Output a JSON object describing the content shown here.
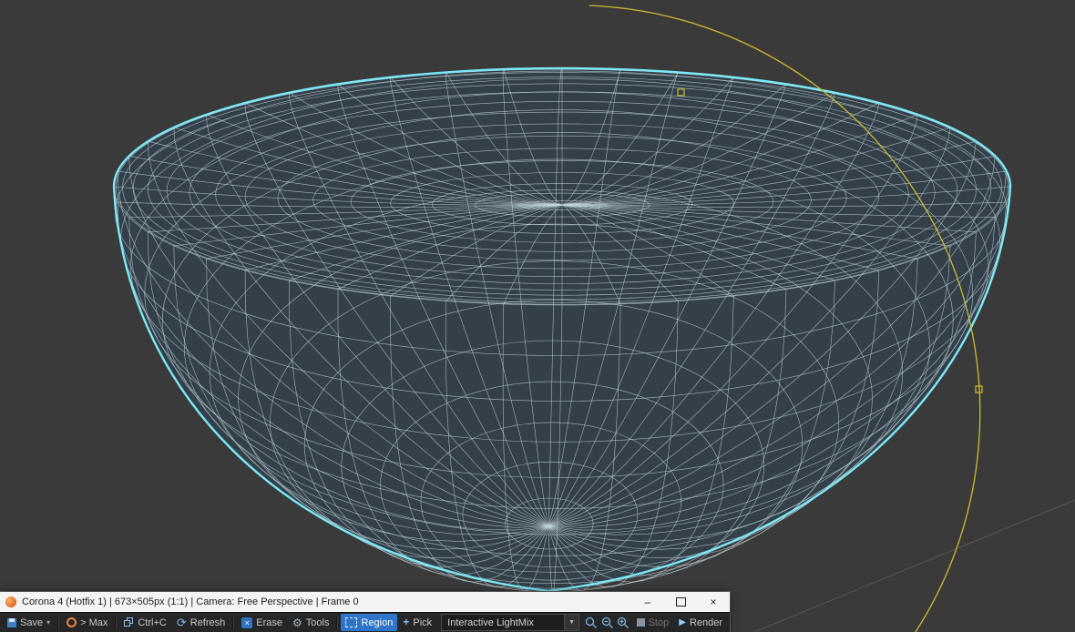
{
  "viewport": {
    "bg_color": "#3a3a3a",
    "selection_outline_color": "#7ce9f7",
    "wire_color": "#c4d8e0",
    "mesh_fill_color": "#333f49",
    "spline_color": "#cfbc2d",
    "grid_line_color": "#5c5c5c",
    "mesh": {
      "longitude_lines": 48,
      "latitude_rings": 32
    }
  },
  "vfb": {
    "title": "Corona 4 (Hotfix 1) | 673×505px (1:1) | Camera: Free Perspective | Frame 0",
    "window_controls": {
      "minimize_glyph": "–",
      "close_glyph": "×"
    },
    "toolbar": {
      "save_label": "Save",
      "to_max_label": "> Max",
      "copy_label": "Ctrl+C",
      "refresh_label": "Refresh",
      "erase_label": "Erase",
      "tools_label": "Tools",
      "region_label": "Region",
      "pick_label": "Pick",
      "lightmix_value": "Interactive LightMix",
      "stop_label": "Stop",
      "render_label": "Render"
    },
    "icons": {
      "dropdown_glyph": "▾",
      "refresh_glyph": "⟳",
      "erase_glyph": "×",
      "gear_glyph": "⚙",
      "pick_glyph": "+",
      "render_glyph": "▶",
      "combo_arrow_glyph": "▼"
    }
  }
}
